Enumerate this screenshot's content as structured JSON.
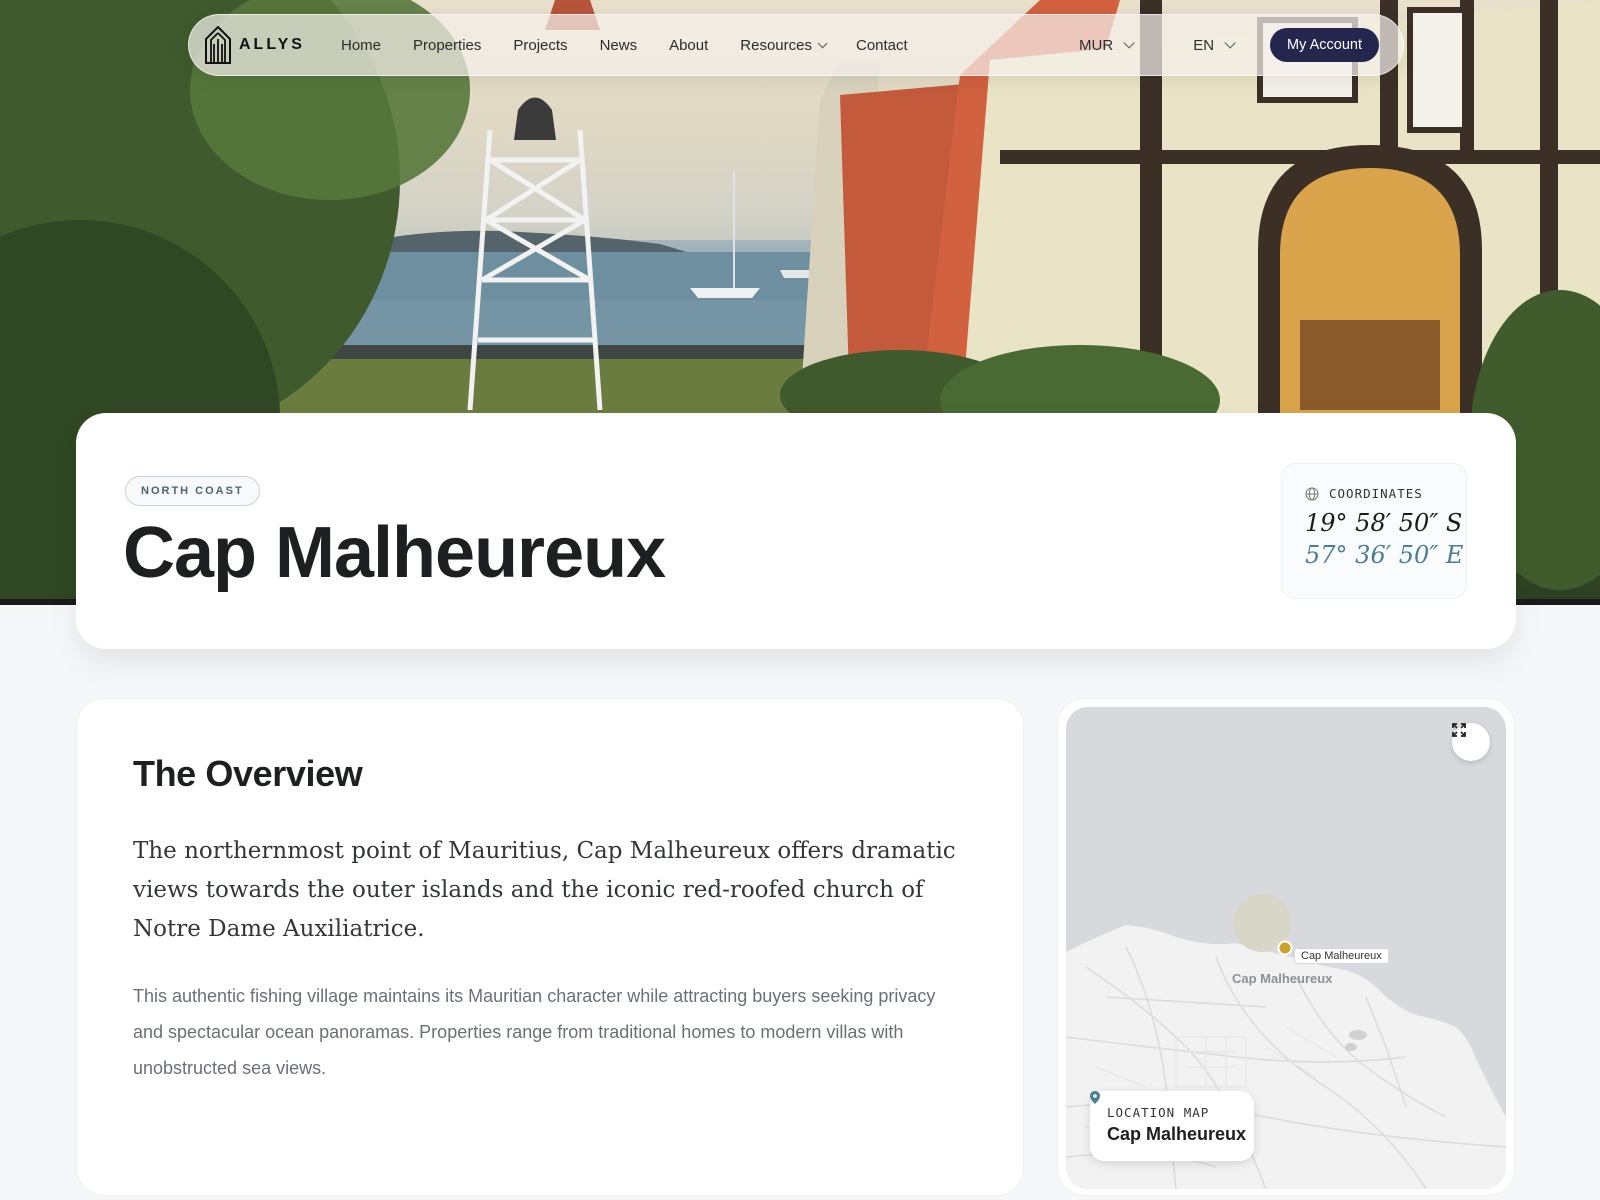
{
  "nav": {
    "brand": "ALLYS",
    "links": [
      {
        "label": "Home"
      },
      {
        "label": "Properties"
      },
      {
        "label": "Projects"
      },
      {
        "label": "News"
      },
      {
        "label": "About"
      },
      {
        "label": "Resources"
      },
      {
        "label": "Contact"
      }
    ],
    "currency": "MUR",
    "language": "EN",
    "account_label": "My Account"
  },
  "hero": {
    "region_tag": "NORTH COAST",
    "title": "Cap Malheureux",
    "coordinates_label": "COORDINATES",
    "latitude": "19° 58′ 50″ S",
    "longitude": "57° 36′ 50″ E"
  },
  "overview": {
    "heading": "The Overview",
    "lead": "The northernmost point of Mauritius, Cap Malheureux offers dramatic views towards the outer islands and the iconic red-roofed church of Notre Dame Auxiliatrice.",
    "body": "This authentic fishing village maintains its Mauritian character while attracting buyers seeking privacy and spectacular ocean panoramas. Properties range from traditional homes to modern villas with unobstructed sea views."
  },
  "map": {
    "pin_label": "Cap Malheureux",
    "place_label": "Cap Malheureux",
    "info_label": "LOCATION MAP",
    "info_place": "Cap Malheureux"
  },
  "colors": {
    "accent_navy": "#25264d",
    "coord_teal": "#4b7f93",
    "pin_yellow": "#c9a227"
  }
}
